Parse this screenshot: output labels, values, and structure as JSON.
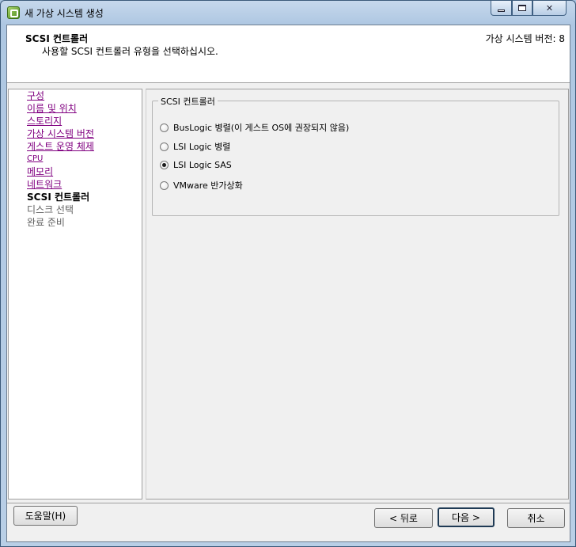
{
  "window": {
    "title": "새 가상 시스템 생성",
    "controls": {
      "minimize": "minimize",
      "maximize": "maximize",
      "close": "close"
    }
  },
  "header": {
    "title": "SCSI 컨트롤러",
    "subtitle": "사용할 SCSI 컨트롤러 유형을 선택하십시오.",
    "version": "가상 시스템 버전: 8"
  },
  "sidebar": {
    "items": [
      {
        "label": "구성",
        "state": "link"
      },
      {
        "label": "이름 및 위치",
        "state": "link"
      },
      {
        "label": "스토리지",
        "state": "link"
      },
      {
        "label": "가상 시스템 버전",
        "state": "link"
      },
      {
        "label": "게스트 운영 체제",
        "state": "link"
      },
      {
        "label": "CPU",
        "state": "link"
      },
      {
        "label": "메모리",
        "state": "link"
      },
      {
        "label": "네트워크",
        "state": "link"
      },
      {
        "label": "SCSI 컨트롤러",
        "state": "current"
      },
      {
        "label": "디스크 선택",
        "state": "pending"
      },
      {
        "label": "완료 준비",
        "state": "pending"
      }
    ]
  },
  "main": {
    "group_label": "SCSI 컨트롤러",
    "options": [
      {
        "label": "BusLogic 병렬(이 게스트 OS에 권장되지 않음)",
        "checked": false
      },
      {
        "label": "LSI Logic 병렬",
        "checked": false
      },
      {
        "label": "LSI Logic SAS",
        "checked": true
      },
      {
        "label": "VMware 반가상화",
        "checked": false
      }
    ]
  },
  "footer": {
    "help_label": "도움말(H)",
    "back_label": "< 뒤로",
    "next_label": "다음 >",
    "cancel_label": "취소"
  },
  "colors": {
    "visited_link": "#800080",
    "title_bar": "#aec7e2",
    "dialog_bg": "#f0f0f0"
  }
}
